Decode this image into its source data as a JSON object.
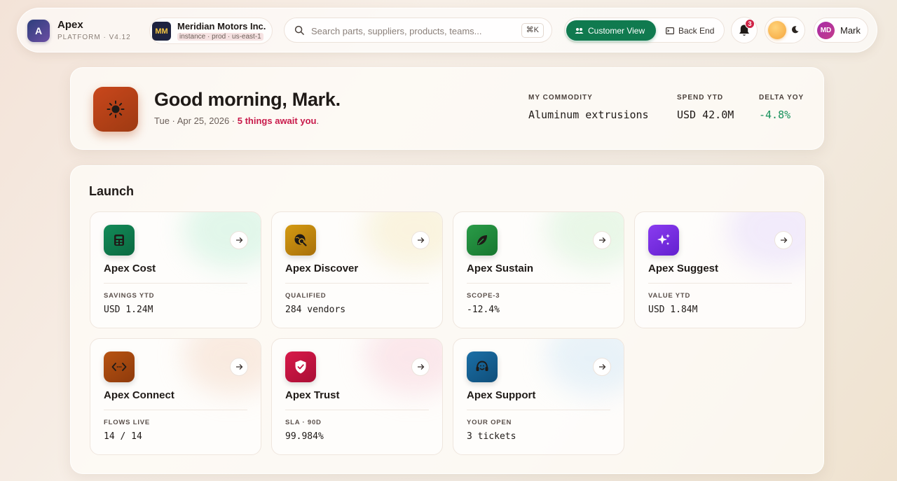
{
  "brand": {
    "logo_letter": "A",
    "name": "Apex",
    "version": "PLATFORM · V4.12"
  },
  "tenant": {
    "logo": "MM",
    "name": "Meridian Motors Inc.",
    "env": "instance · prod · us-east-1"
  },
  "search": {
    "placeholder": "Search parts, suppliers, products, teams...",
    "shortcut": "⌘K",
    "icon": "search-icon"
  },
  "view_toggle": {
    "active": "Customer View",
    "inactive": "Back End"
  },
  "notifications": {
    "count": "3",
    "icon": "bell-icon"
  },
  "theme": {
    "icons": [
      "sun-icon",
      "moon-icon"
    ]
  },
  "user": {
    "initials": "MD",
    "name": "Mark"
  },
  "greeting": {
    "title": "Good morning, Mark.",
    "date": "Tue · Apr 25, 2026 · ",
    "alert": "5 things await you",
    "suffix": ".",
    "icon": "sun-icon"
  },
  "stats": [
    {
      "label": "MY COMMODITY",
      "value": "Aluminum extrusions"
    },
    {
      "label": "SPEND YTD",
      "value": "USD 42.0M"
    },
    {
      "label": "DELTA YOY",
      "value": "-4.8%",
      "color": "#15905a"
    }
  ],
  "launch": {
    "title": "Launch",
    "cards": [
      {
        "name": "Apex Cost",
        "label": "SAVINGS YTD",
        "value": "USD 1.24M",
        "icon": "calculator-icon",
        "color": "#0f7a4c"
      },
      {
        "name": "Apex Discover",
        "label": "QUALIFIED",
        "value": "284 vendors",
        "icon": "globe-search-icon",
        "color": "#b9800c"
      },
      {
        "name": "Apex Sustain",
        "label": "SCOPE-3",
        "value": "-12.4%",
        "icon": "leaf-icon",
        "color": "#1f8a3a"
      },
      {
        "name": "Apex Suggest",
        "label": "VALUE YTD",
        "value": "USD 1.84M",
        "icon": "sparkles-icon",
        "color": "#7b2fe0"
      },
      {
        "name": "Apex Connect",
        "label": "FLOWS LIVE",
        "value": "14 / 14",
        "icon": "code-icon",
        "color": "#a8450f"
      },
      {
        "name": "Apex Trust",
        "label": "SLA · 90D",
        "value": "99.984%",
        "icon": "shield-check-icon",
        "color": "#c4123f"
      },
      {
        "name": "Apex Support",
        "label": "YOUR OPEN",
        "value": "3 tickets",
        "icon": "headset-icon",
        "color": "#145b8a"
      }
    ]
  }
}
